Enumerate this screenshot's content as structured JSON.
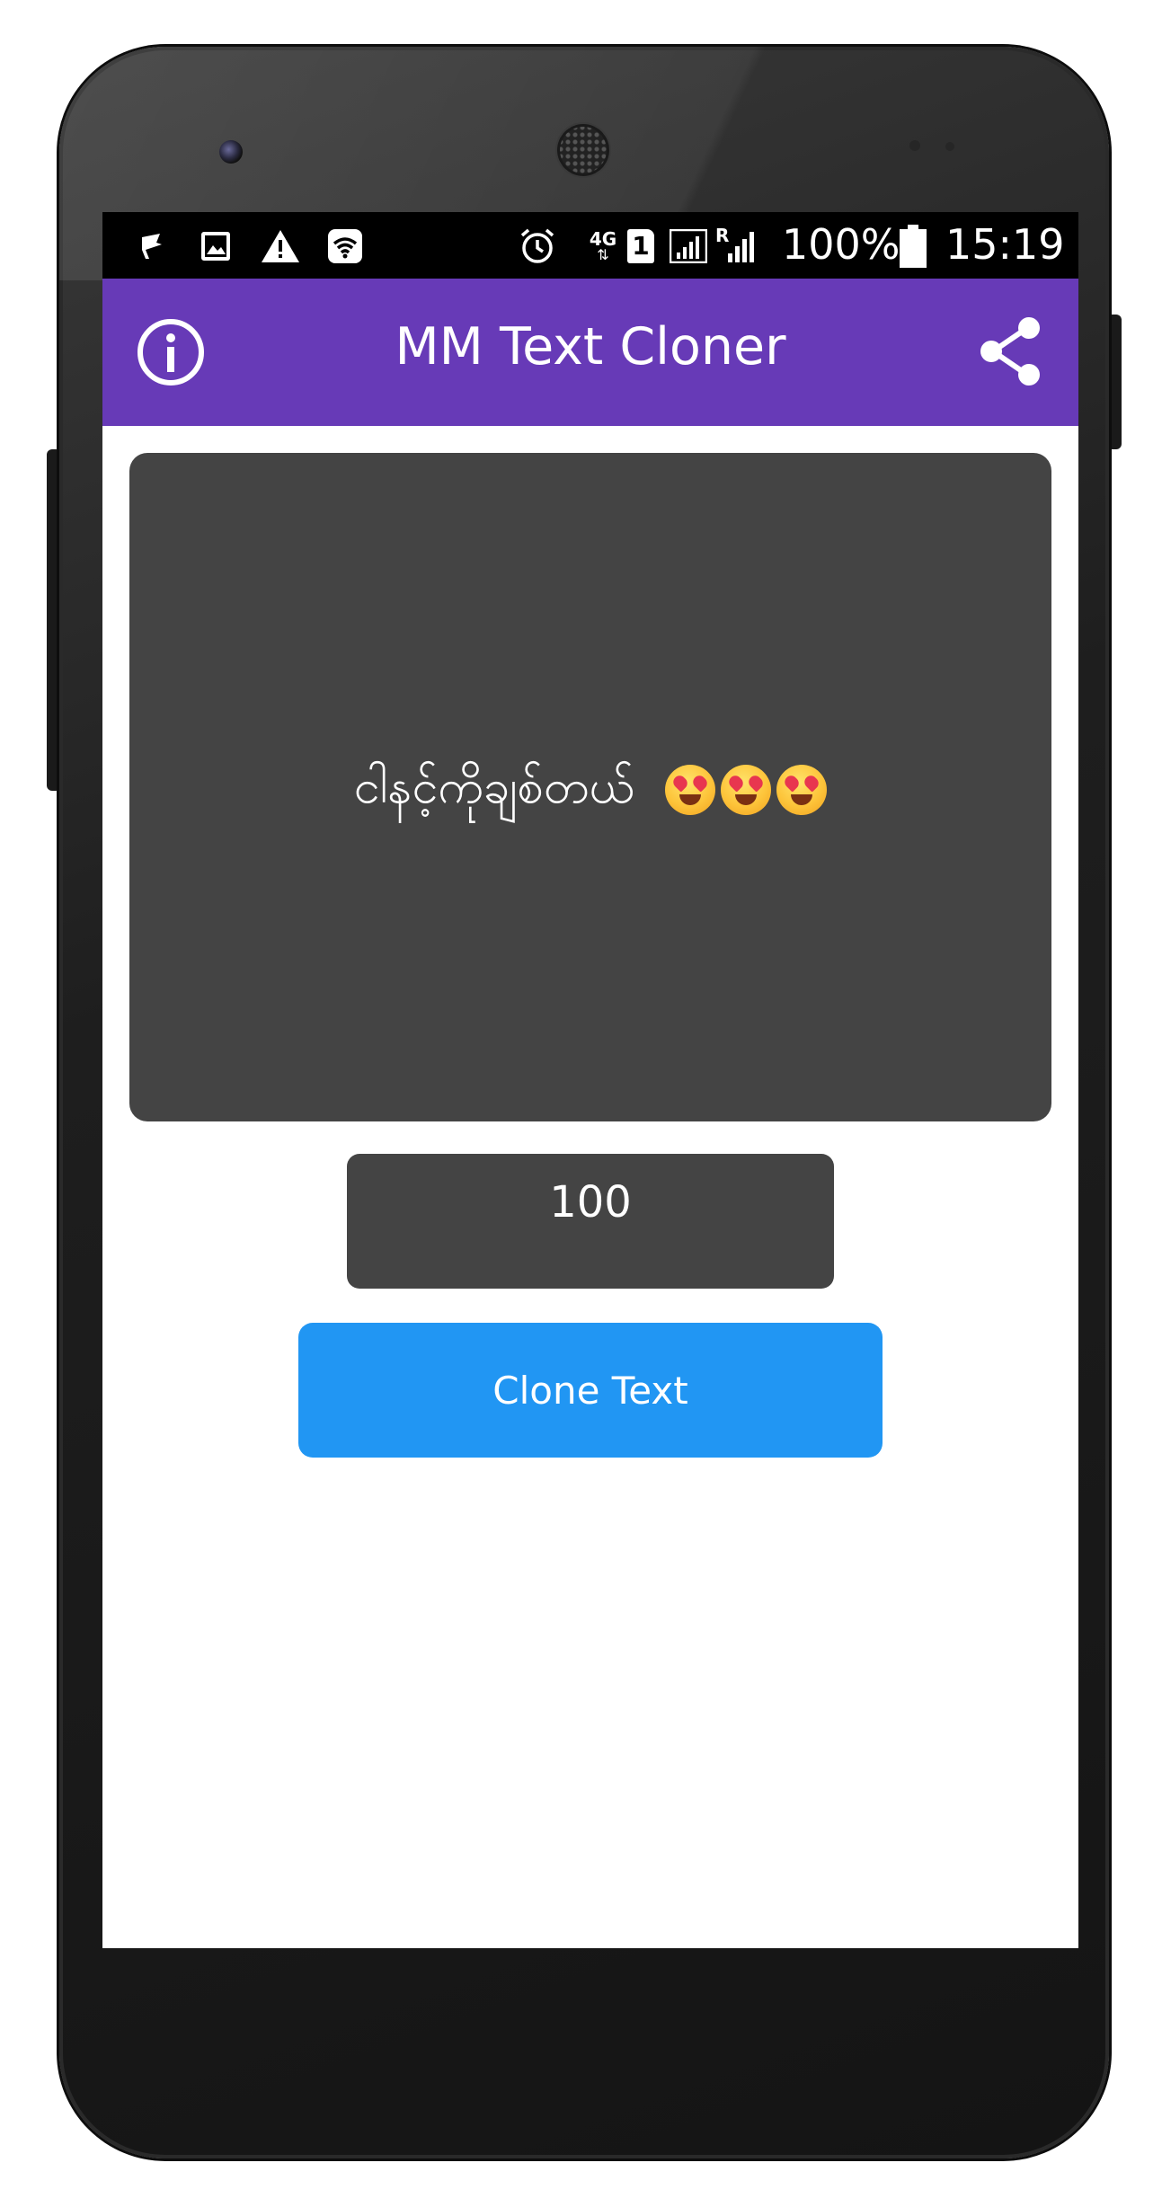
{
  "status_bar": {
    "left_icons": [
      "notification-flag-icon",
      "image-icon",
      "warning-icon",
      "wifi-icon"
    ],
    "right_icons": [
      "alarm-icon",
      "network-4g-icon",
      "sim-1-icon",
      "signal-icon",
      "roaming-signal-icon"
    ],
    "network_label": "4G",
    "sim_label": "1",
    "roaming_label": "R",
    "battery_text": "100%",
    "time": "15:19"
  },
  "app_bar": {
    "title": "MM Text Cloner",
    "left_icon": "info-icon",
    "right_icon": "share-icon"
  },
  "main": {
    "display_text": "ငါနင့်ကိုချစ်တယ်",
    "emoji_icons": [
      "heart-eyes-emoji-icon",
      "heart-eyes-emoji-icon",
      "heart-eyes-emoji-icon"
    ],
    "count_value": "100",
    "clone_button_label": "Clone Text"
  },
  "colors": {
    "app_bar": "#673ab7",
    "status_bar": "#000000",
    "panel": "#444444",
    "button": "#2196f3",
    "text": "#ffffff"
  }
}
